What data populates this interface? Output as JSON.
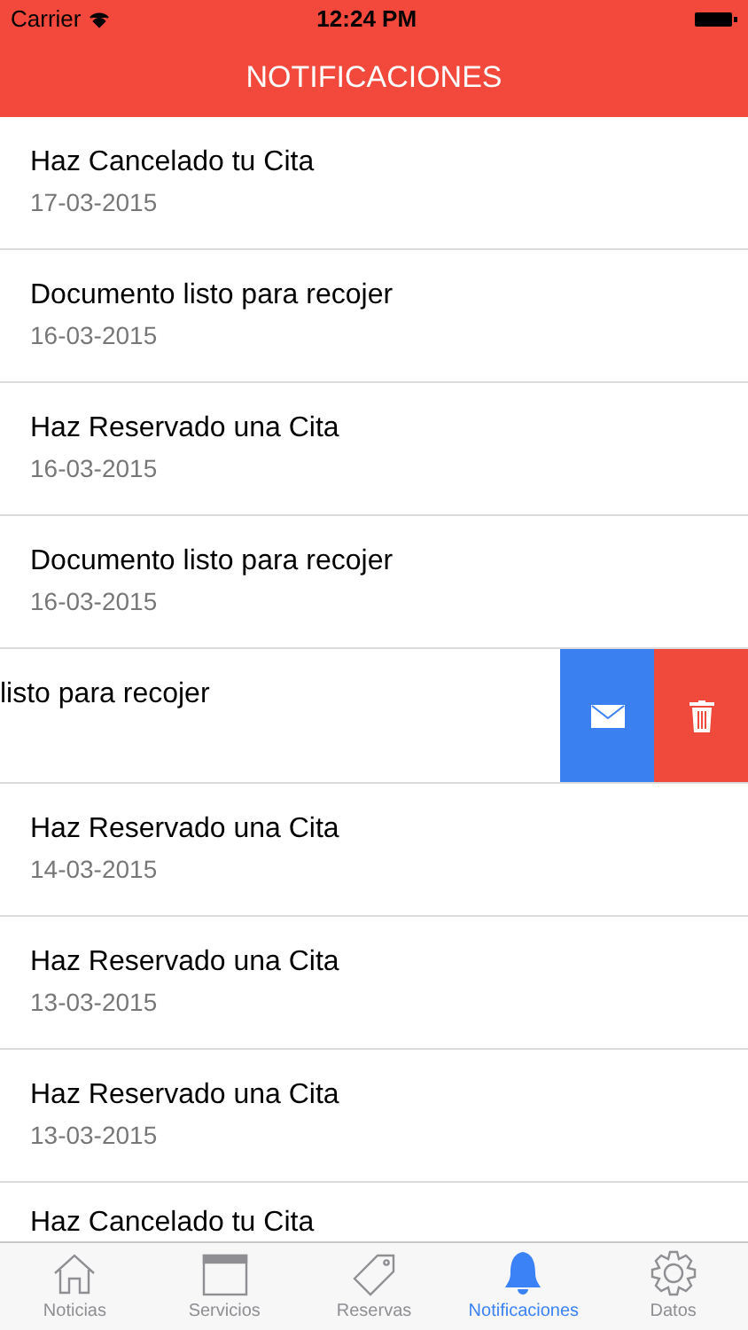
{
  "status_bar": {
    "carrier": "Carrier",
    "time": "12:24 PM"
  },
  "nav": {
    "title": "NOTIFICACIONES"
  },
  "notifications": [
    {
      "kind": "normal",
      "title": "Haz Cancelado tu Cita",
      "date": "17-03-2015"
    },
    {
      "kind": "normal",
      "title": "Documento listo para recojer",
      "date": "16-03-2015"
    },
    {
      "kind": "normal",
      "title": "Haz Reservado una Cita",
      "date": "16-03-2015"
    },
    {
      "kind": "normal",
      "title": "Documento listo para recojer",
      "date": "16-03-2015"
    },
    {
      "kind": "swiped",
      "title": "listo para recojer"
    },
    {
      "kind": "normal",
      "title": "Haz Reservado una Cita",
      "date": "14-03-2015"
    },
    {
      "kind": "normal",
      "title": "Haz Reservado una Cita",
      "date": "13-03-2015"
    },
    {
      "kind": "normal",
      "title": "Haz Reservado una Cita",
      "date": "13-03-2015"
    },
    {
      "kind": "partial",
      "title": "Haz Cancelado tu Cita"
    }
  ],
  "tab_bar": [
    {
      "kind": "home",
      "label": "Noticias",
      "selected": false
    },
    {
      "kind": "calendar",
      "label": "Servicios",
      "selected": false
    },
    {
      "kind": "tag",
      "label": "Reservas",
      "selected": false
    },
    {
      "kind": "bell",
      "label": "Notificaciones",
      "selected": true
    },
    {
      "kind": "gear",
      "label": "Datos",
      "selected": false
    }
  ]
}
